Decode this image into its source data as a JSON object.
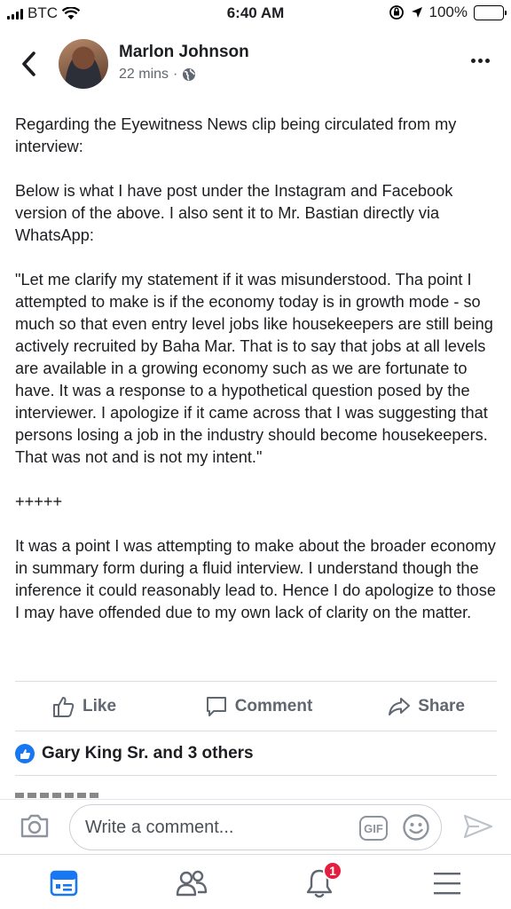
{
  "status_bar": {
    "carrier": "BTC",
    "time": "6:40 AM",
    "battery": "100%",
    "battery_level": 1.0,
    "battery_color": "#f7c600"
  },
  "post": {
    "author": "Marlon Johnson",
    "time_ago": "22 mins",
    "separator": "·",
    "privacy_icon": "globe-icon",
    "body": "Regarding the Eyewitness News clip being circulated from my interview:\n\nBelow is what I have post under the Instagram and Facebook version of the above.  I also sent it to Mr. Bastian directly via WhatsApp:\n\n\"Let me clarify my statement if it was misunderstood.  Tha point I attempted to make is if the economy today is in growth mode - so much so that even entry level jobs like housekeepers are still being actively recruited by Baha Mar. That is to say that jobs at all levels are available in a growing economy such as we are fortunate to have.  It was a response to a hypothetical question posed by the interviewer.  I apologize if it came across that I was suggesting that persons losing a job in the industry should become housekeepers. That was not and is not my intent.\"\n\n+++++\n\nIt was a point I was attempting to make about the broader economy in summary form during a fluid interview.  I understand though the inference it could reasonably lead to. Hence I do apologize to those I may have offended due to my own lack of clarity on the matter."
  },
  "actions": {
    "like": "Like",
    "comment": "Comment",
    "share": "Share"
  },
  "reactions": {
    "text": "Gary King Sr. and 3 others"
  },
  "composer": {
    "placeholder": "Write a comment...",
    "gif": "GIF"
  },
  "tab_bar": {
    "notification_count": "1",
    "accent": "#1877f2",
    "badge_color": "#e41e3f"
  }
}
